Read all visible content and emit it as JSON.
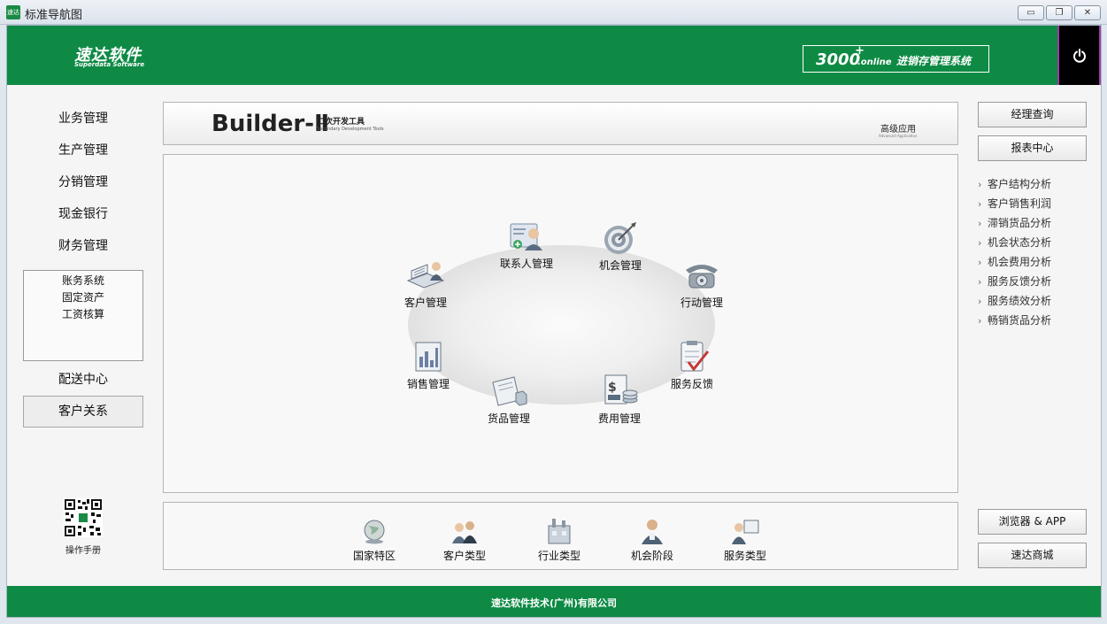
{
  "window": {
    "title": "标准导航图",
    "icon_text": "速达",
    "controls": {
      "minimize": "▭",
      "restore": "❐",
      "close": "✕"
    }
  },
  "header": {
    "logo_main": "速达软件",
    "logo_sub": "Superdata Software",
    "product_number": "3000",
    "product_plus": "+",
    "product_edition": ".online",
    "product_name": "进销存管理系统",
    "power_icon": "power-icon"
  },
  "nav": {
    "items": [
      "业务管理",
      "生产管理",
      "分销管理",
      "现金银行",
      "财务管理"
    ],
    "sub_items": [
      "账务系统",
      "固定资产",
      "工资核算"
    ],
    "delivery": "配送中心",
    "crm": "客户关系",
    "manual_label": "操作手册"
  },
  "banner": {
    "title": "Builder-Ⅱ",
    "subtitle_cn": "二次开发工具",
    "subtitle_en": "Secondary Development Tools",
    "advanced_cn": "高级应用",
    "advanced_en": "Advanced Application"
  },
  "modules": [
    {
      "label": "联系人管理",
      "icon": "contact-card-icon"
    },
    {
      "label": "机会管理",
      "icon": "target-icon"
    },
    {
      "label": "客户管理",
      "icon": "customer-desk-icon"
    },
    {
      "label": "行动管理",
      "icon": "telephone-icon"
    },
    {
      "label": "销售管理",
      "icon": "sales-chart-icon"
    },
    {
      "label": "服务反馈",
      "icon": "checklist-icon"
    },
    {
      "label": "货品管理",
      "icon": "goods-icon"
    },
    {
      "label": "费用管理",
      "icon": "money-icon"
    }
  ],
  "categories": [
    {
      "label": "国家特区",
      "icon": "globe-icon"
    },
    {
      "label": "客户类型",
      "icon": "people-icon"
    },
    {
      "label": "行业类型",
      "icon": "industry-icon"
    },
    {
      "label": "机会阶段",
      "icon": "person-icon"
    },
    {
      "label": "服务类型",
      "icon": "presenter-icon"
    }
  ],
  "right": {
    "manager_query": "经理查询",
    "report_center": "报表中心",
    "links": [
      "客户结构分析",
      "客户销售利润",
      "滞销货品分析",
      "机会状态分析",
      "机会费用分析",
      "服务反馈分析",
      "服务绩效分析",
      "畅销货品分析"
    ],
    "browser_app": "浏览器 & APP",
    "mall": "速达商城"
  },
  "footer": {
    "company": "速达软件技术(广州)有限公司"
  },
  "colors": {
    "brand_green": "#0f8a45",
    "power_border": "#a33aa8"
  }
}
